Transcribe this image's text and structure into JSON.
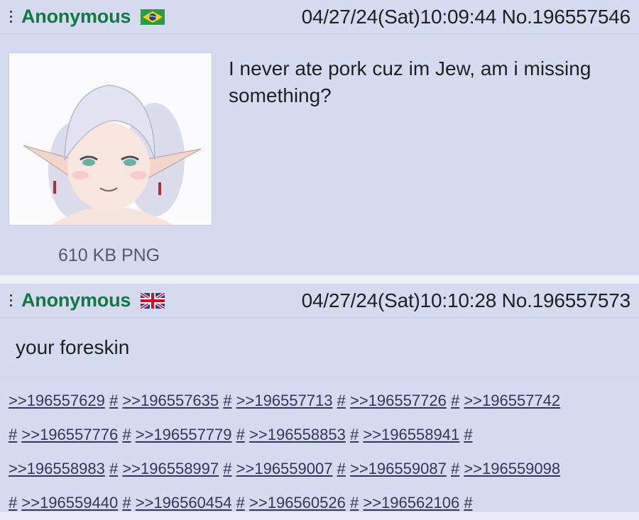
{
  "posts": [
    {
      "name": "Anonymous",
      "flag": "brazil-flag",
      "datetime": "04/27/24(Sat)10:09:44",
      "number": "No.196557546",
      "file_info": "610 KB PNG",
      "message": "I never ate pork cuz im Jew, am i missing something?"
    },
    {
      "name": "Anonymous",
      "flag": "uk-flag",
      "datetime": "04/27/24(Sat)10:10:28",
      "number": "No.196557573",
      "message": "your foreskin"
    }
  ],
  "replies": [
    ">>196557629",
    ">>196557635",
    ">>196557713",
    ">>196557726",
    ">>196557742",
    ">>196557776",
    ">>196557779",
    ">>196558853",
    ">>196558941",
    ">>196558983",
    ">>196558997",
    ">>196559007",
    ">>196559087",
    ">>196559098",
    ">>196559440",
    ">>196560454",
    ">>196560526",
    ">>196562106"
  ],
  "reply_marker": "#",
  "colors": {
    "name": "#117743",
    "post_bg": "#d6daf0",
    "link": "#34345c"
  }
}
